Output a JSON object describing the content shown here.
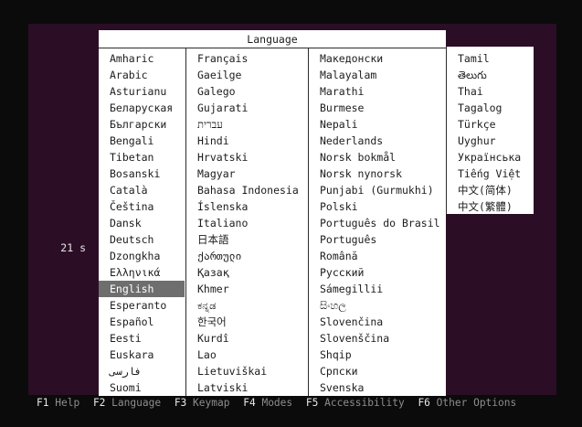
{
  "countdown": "21 s",
  "dialog": {
    "title": "Language"
  },
  "columns": [
    [
      "Amharic",
      "Arabic",
      "Asturianu",
      "Беларуская",
      "Български",
      "Bengali",
      "Tibetan",
      "Bosanski",
      "Català",
      "Čeština",
      "Dansk",
      "Deutsch",
      "Dzongkha",
      "Ελληνικά",
      "English",
      "Esperanto",
      "Español",
      "Eesti",
      "Euskara",
      "فارسی",
      "Suomi"
    ],
    [
      "Français",
      "Gaeilge",
      "Galego",
      "Gujarati",
      "עברית",
      "Hindi",
      "Hrvatski",
      "Magyar",
      "Bahasa Indonesia",
      "Íslenska",
      "Italiano",
      "日本語",
      "ქართული",
      "Қазақ",
      "Khmer",
      "ಕನ್ನಡ",
      "한국어",
      "Kurdî",
      "Lao",
      "Lietuviškai",
      "Latviski"
    ],
    [
      "Македонски",
      "Malayalam",
      "Marathi",
      "Burmese",
      "Nepali",
      "Nederlands",
      "Norsk bokmål",
      "Norsk nynorsk",
      "Punjabi (Gurmukhi)",
      "Polski",
      "Português do Brasil",
      "Português",
      "Română",
      "Русский",
      "Sámegillii",
      "සිංහල",
      "Slovenčina",
      "Slovenščina",
      "Shqip",
      "Српски",
      "Svenska"
    ],
    [
      "Tamil",
      "తెలుగు",
      "Thai",
      "Tagalog",
      "Türkçe",
      "Uyghur",
      "Українська",
      "Tiếng Việt",
      "中文(简体)",
      "中文(繁體)"
    ]
  ],
  "selected": "English",
  "function_keys": [
    {
      "key": "F1",
      "label": "Help"
    },
    {
      "key": "F2",
      "label": "Language"
    },
    {
      "key": "F3",
      "label": "Keymap"
    },
    {
      "key": "F4",
      "label": "Modes"
    },
    {
      "key": "F5",
      "label": "Accessibility"
    },
    {
      "key": "F6",
      "label": "Other Options"
    }
  ]
}
